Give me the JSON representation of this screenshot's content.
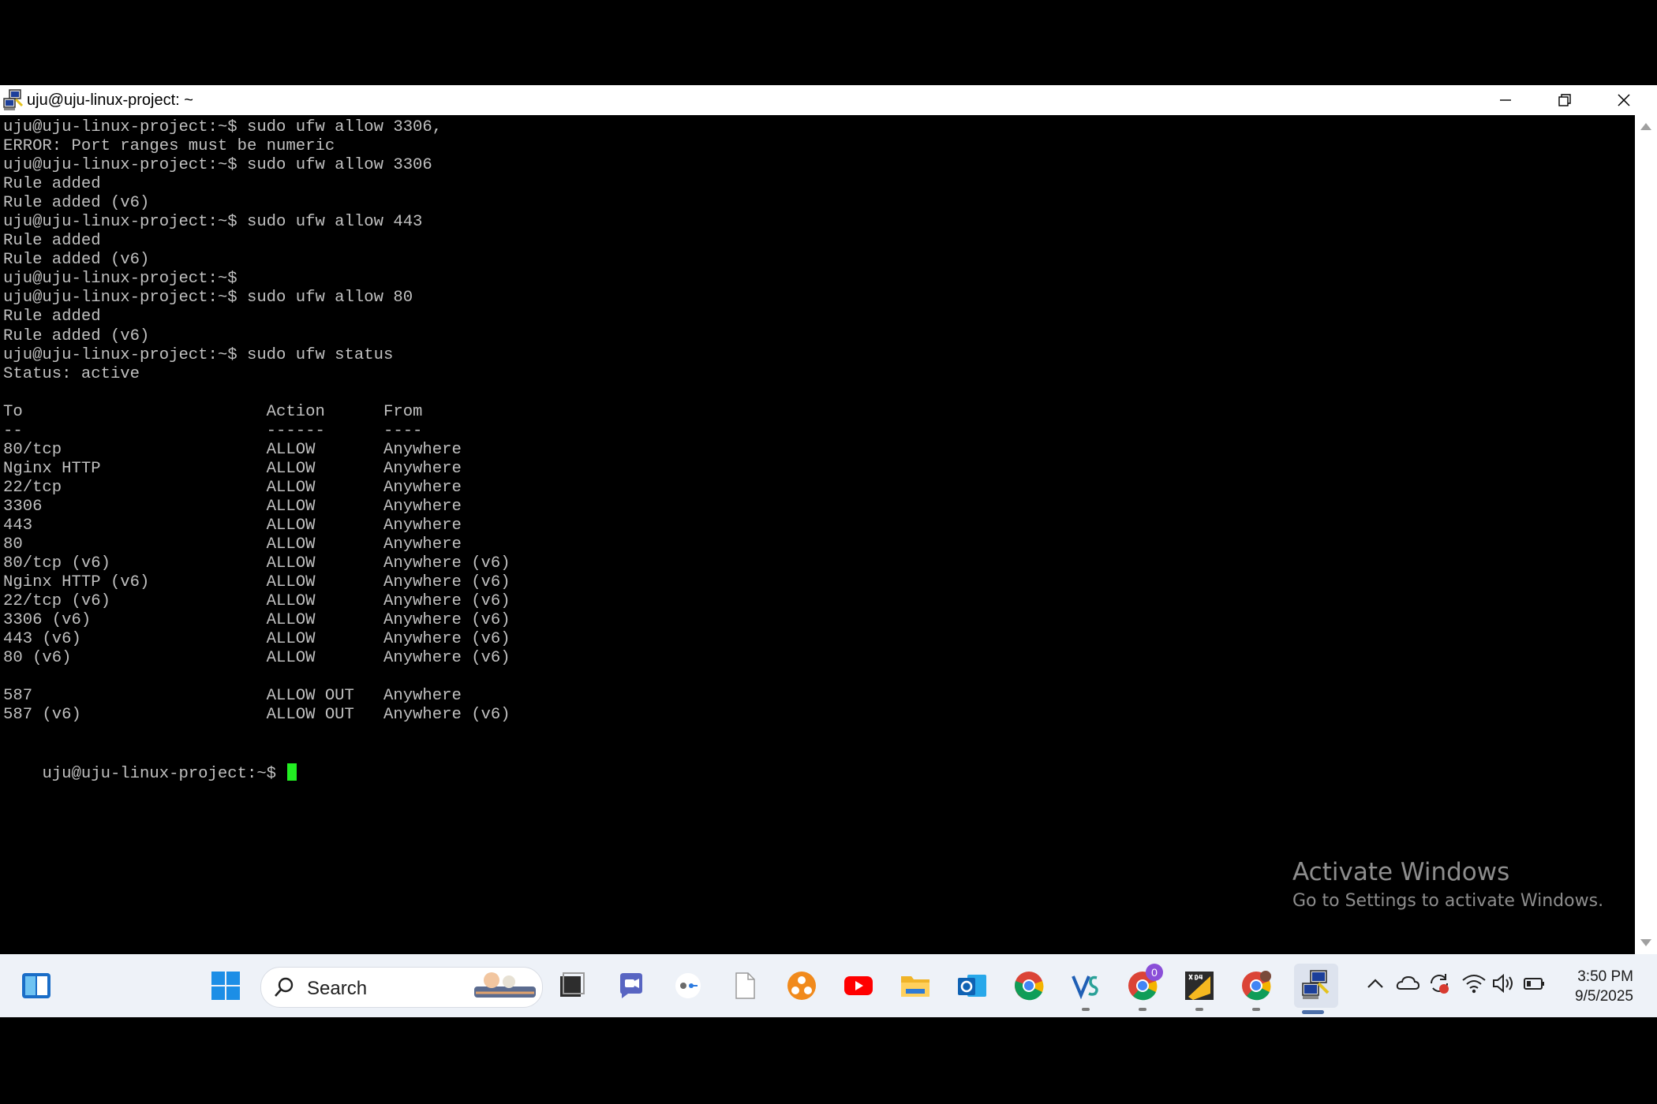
{
  "window": {
    "title": "uju@uju-linux-project: ~"
  },
  "terminal": {
    "lines": [
      "uju@uju-linux-project:~$ sudo ufw allow 3306,",
      "ERROR: Port ranges must be numeric",
      "uju@uju-linux-project:~$ sudo ufw allow 3306",
      "Rule added",
      "Rule added (v6)",
      "uju@uju-linux-project:~$ sudo ufw allow 443",
      "Rule added",
      "Rule added (v6)",
      "uju@uju-linux-project:~$",
      "uju@uju-linux-project:~$ sudo ufw allow 80",
      "Rule added",
      "Rule added (v6)",
      "uju@uju-linux-project:~$ sudo ufw status",
      "Status: active",
      "",
      "To                         Action      From",
      "--                         ------      ----",
      "80/tcp                     ALLOW       Anywhere",
      "Nginx HTTP                 ALLOW       Anywhere",
      "22/tcp                     ALLOW       Anywhere",
      "3306                       ALLOW       Anywhere",
      "443                        ALLOW       Anywhere",
      "80                         ALLOW       Anywhere",
      "80/tcp (v6)                ALLOW       Anywhere (v6)",
      "Nginx HTTP (v6)            ALLOW       Anywhere (v6)",
      "22/tcp (v6)                ALLOW       Anywhere (v6)",
      "3306 (v6)                  ALLOW       Anywhere (v6)",
      "443 (v6)                   ALLOW       Anywhere (v6)",
      "80 (v6)                    ALLOW       Anywhere (v6)",
      "",
      "587                        ALLOW OUT   Anywhere",
      "587 (v6)                   ALLOW OUT   Anywhere (v6)",
      ""
    ],
    "prompt": "uju@uju-linux-project:~$ ",
    "cursor_color": "#22ee22",
    "text_color": "#c0c0c0"
  },
  "watermark": {
    "title": "Activate Windows",
    "subtitle": "Go to Settings to activate Windows."
  },
  "taskbar": {
    "search_placeholder": "Search",
    "apps": [
      "widgets-icon",
      "start-icon",
      "task-view-icon",
      "teams-icon",
      "password-manager-icon",
      "file-icon",
      "app-orange-icon",
      "youtube-icon",
      "file-explorer-icon",
      "outlook-icon",
      "chrome-icon",
      "vs-icon",
      "chrome-profile-icon",
      "x64-app-icon",
      "chrome-profile-2-icon",
      "putty-icon"
    ],
    "chrome_badge": "0",
    "clock_time": "3:50 PM",
    "clock_date": "9/5/2025"
  }
}
